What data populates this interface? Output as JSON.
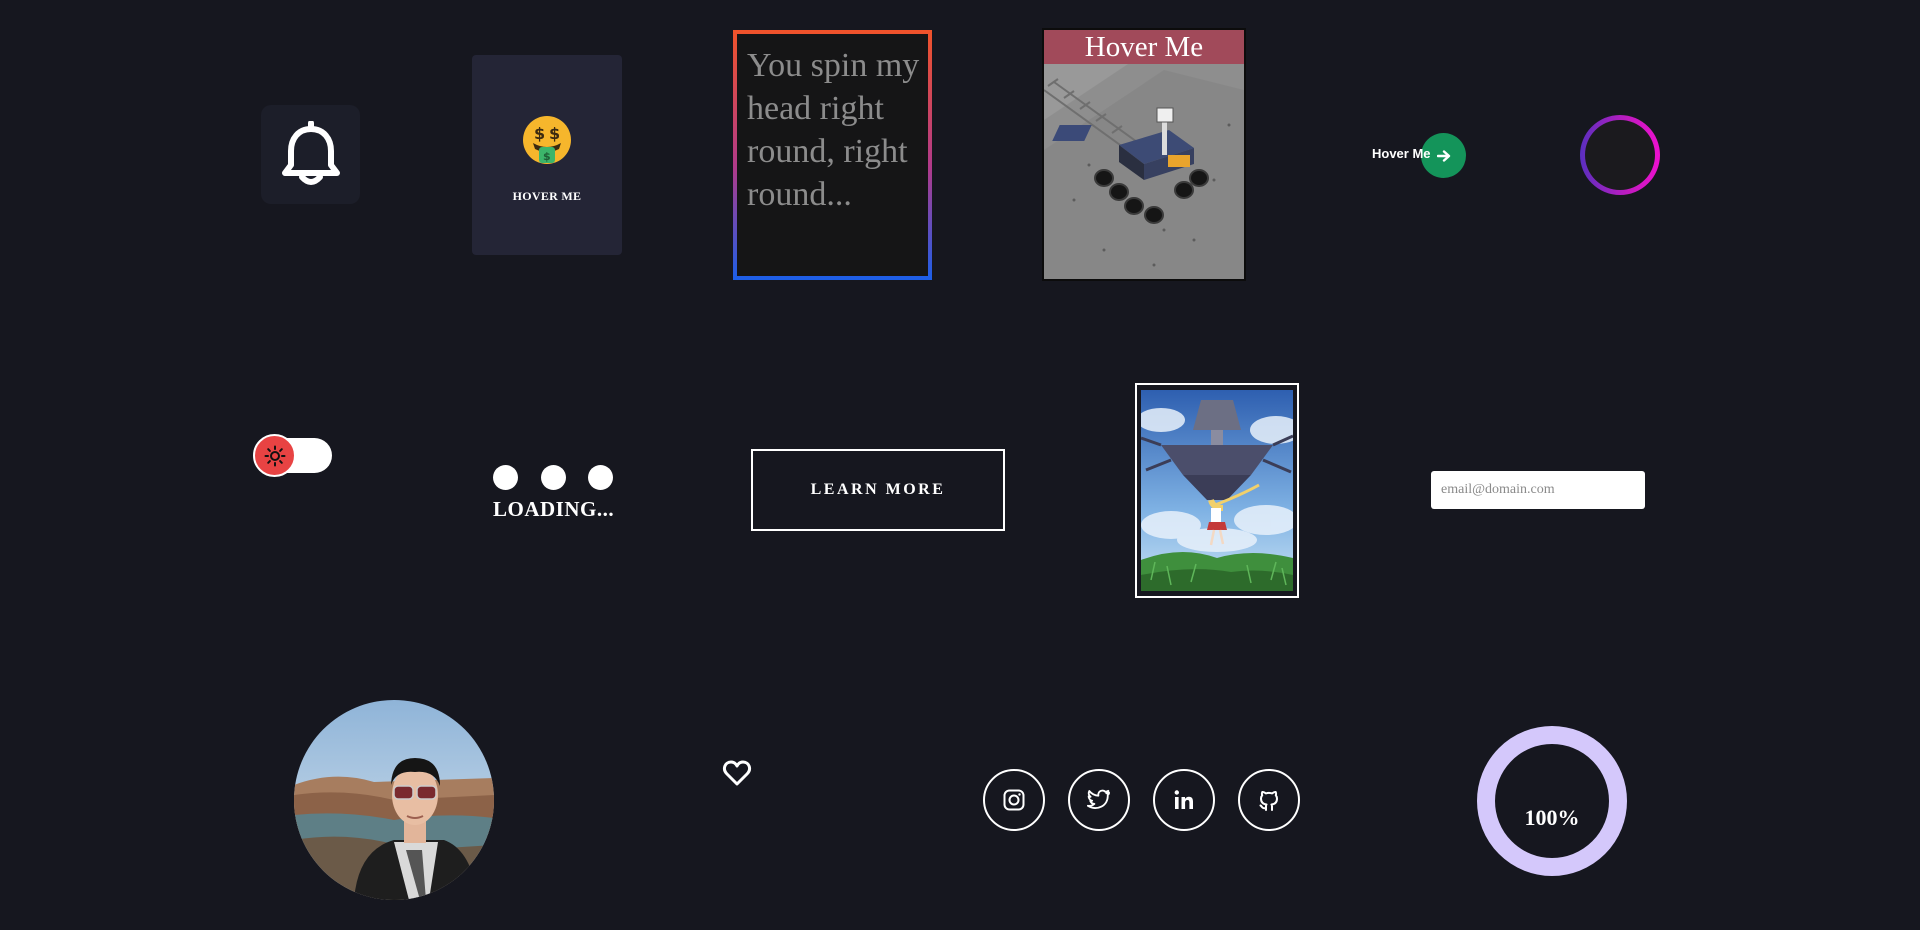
{
  "cards": {
    "emoji_card_label": "HOVER ME",
    "lyric_text": "You spin my head right round, right round...",
    "rover_title": "Hover Me",
    "pill_label": "Hover Me"
  },
  "loader": {
    "label": "LOADING..."
  },
  "cta": {
    "learn_more": "LEARN MORE"
  },
  "newsletter": {
    "email_placeholder": "email@domain.com"
  },
  "social": {
    "items": [
      "instagram-icon",
      "twitter-icon",
      "linkedin-icon",
      "github-icon"
    ]
  },
  "progress": {
    "value_label": "100%",
    "value": 1.0
  },
  "toggle": {
    "state": "off",
    "icon": "sun-icon"
  },
  "colors": {
    "background": "#16171f",
    "toggle_knob": "#e84343",
    "pill_green": "#14945a",
    "progress_ring": "#d4c8fb",
    "rover_title_bg": "#a14a5a"
  }
}
